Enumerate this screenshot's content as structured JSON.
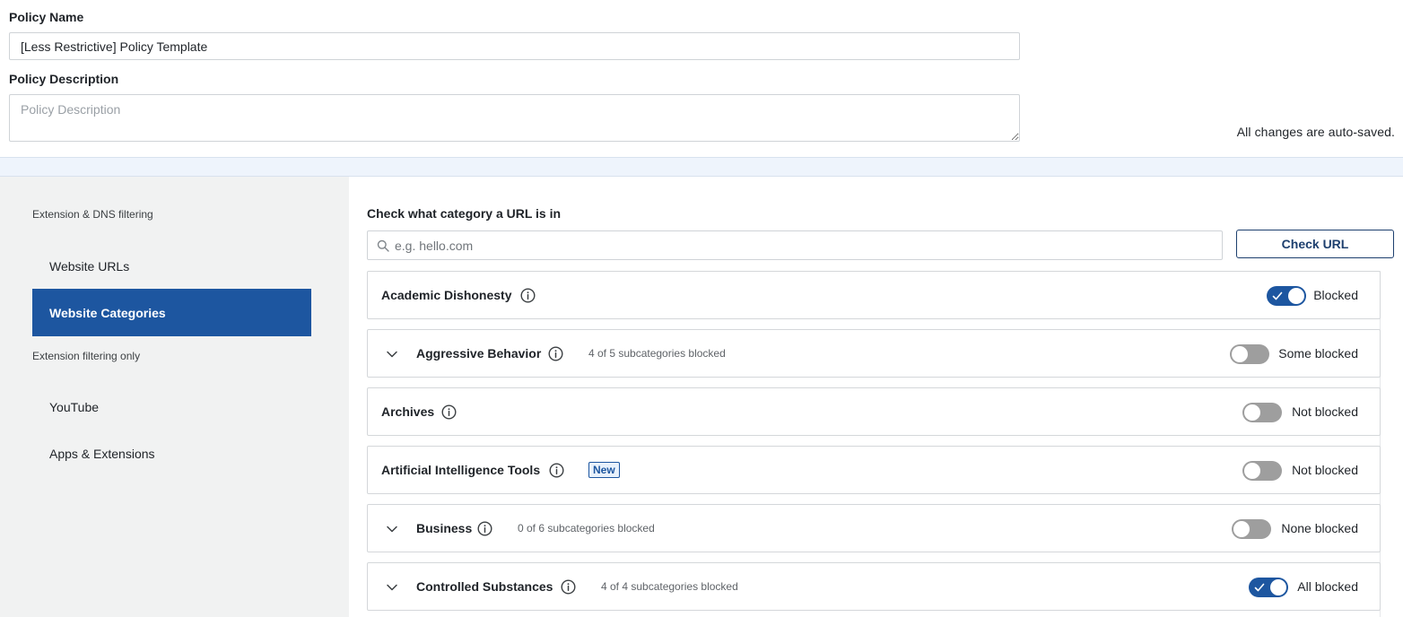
{
  "policy": {
    "name_label": "Policy Name",
    "name_value": "[Less Restrictive] Policy Template",
    "description_label": "Policy Description",
    "description_placeholder": "Policy Description",
    "autosave_text": "All changes are auto-saved."
  },
  "sidebar": {
    "section_dns": "Extension & DNS filtering",
    "section_ext": "Extension filtering only",
    "items": [
      {
        "label": "Website URLs",
        "active": false
      },
      {
        "label": "Website Categories",
        "active": true
      },
      {
        "label": "YouTube",
        "active": false
      },
      {
        "label": "Apps & Extensions",
        "active": false
      }
    ]
  },
  "url_check": {
    "label": "Check what category a URL is in",
    "placeholder": "e.g. hello.com",
    "button_label": "Check URL"
  },
  "categories": [
    {
      "name": "Academic Dishonesty",
      "expandable": false,
      "subcount": "",
      "badge": "",
      "toggle_on": true,
      "status": "Blocked"
    },
    {
      "name": "Aggressive Behavior",
      "expandable": true,
      "subcount": "4 of 5 subcategories blocked",
      "badge": "",
      "toggle_on": false,
      "status": "Some blocked"
    },
    {
      "name": "Archives",
      "expandable": false,
      "subcount": "",
      "badge": "",
      "toggle_on": false,
      "status": "Not blocked"
    },
    {
      "name": "Artificial Intelligence Tools",
      "expandable": false,
      "subcount": "",
      "badge": "New",
      "toggle_on": false,
      "status": "Not blocked"
    },
    {
      "name": "Business",
      "expandable": true,
      "subcount": "0 of 6 subcategories blocked",
      "badge": "",
      "toggle_on": false,
      "status": "None blocked"
    },
    {
      "name": "Controlled Substances",
      "expandable": true,
      "subcount": "4 of 4 subcategories blocked",
      "badge": "",
      "toggle_on": true,
      "status": "All blocked"
    }
  ],
  "colors": {
    "accent": "#1d56a0",
    "toggle_off": "#9e9e9e",
    "sidebar_bg": "#f1f2f2",
    "band_bg": "#eef4fc"
  },
  "icons": {
    "chevron": "chevron-down-icon",
    "info": "info-icon",
    "search": "search-icon",
    "check": "check-icon"
  }
}
